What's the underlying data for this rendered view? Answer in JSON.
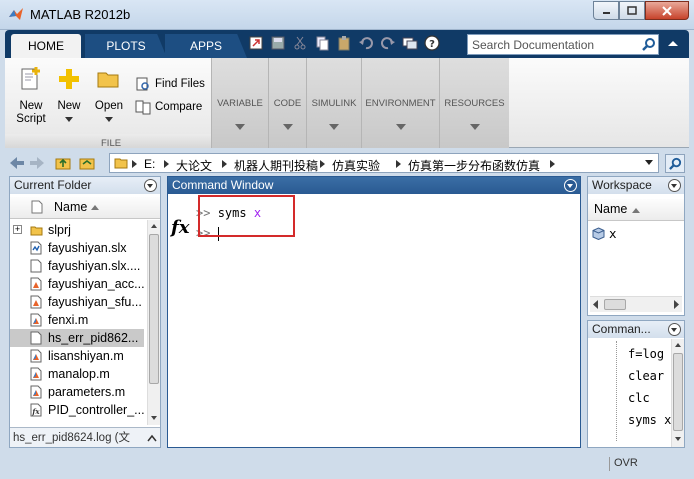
{
  "window": {
    "title": "MATLAB R2012b"
  },
  "ribbon_tabs": [
    "HOME",
    "PLOTS",
    "APPS"
  ],
  "search": {
    "placeholder": "Search Documentation"
  },
  "file_section": {
    "label": "FILE",
    "new_script": "New\nScript",
    "new": "New",
    "open": "Open",
    "find_files": "Find Files",
    "compare": "Compare"
  },
  "ribbon_groups": [
    "VARIABLE",
    "CODE",
    "SIMULINK",
    "ENVIRONMENT",
    "RESOURCES"
  ],
  "path": {
    "drive": "E:",
    "crumbs": [
      "大论文",
      "机器人期刊投稿",
      "仿真实验",
      "仿真第一步分布函数仿真"
    ]
  },
  "current_folder": {
    "title": "Current Folder",
    "column": "Name",
    "files": [
      {
        "name": "slprj",
        "type": "folder"
      },
      {
        "name": "fayushiyan.slx",
        "type": "slx"
      },
      {
        "name": "fayushiyan.slx....",
        "type": "file"
      },
      {
        "name": "fayushiyan_acc...",
        "type": "mex"
      },
      {
        "name": "fayushiyan_sfu...",
        "type": "mex"
      },
      {
        "name": "fenxi.m",
        "type": "m"
      },
      {
        "name": "hs_err_pid862...",
        "type": "file"
      },
      {
        "name": "lisanshiyan.m",
        "type": "m"
      },
      {
        "name": "manalop.m",
        "type": "m"
      },
      {
        "name": "parameters.m",
        "type": "m"
      },
      {
        "name": "PID_controller_...",
        "type": "fx"
      }
    ],
    "selected_index": 6,
    "detail": "hs_err_pid8624.log (文"
  },
  "command_window": {
    "title": "Command Window",
    "prompt": ">>",
    "line1_cmd": "syms",
    "line1_arg": "x",
    "fx_label": "fx"
  },
  "workspace": {
    "title": "Workspace",
    "column": "Name",
    "variables": [
      "x"
    ]
  },
  "command_history": {
    "title": "Comman...",
    "entries": [
      "f=log",
      "clear",
      "clc",
      "syms x"
    ]
  },
  "status": {
    "ovr": "OVR"
  },
  "colors": {
    "accent": "#e8463a",
    "tab_dark": "#103a66",
    "keyword_arg": "#a020f0"
  }
}
